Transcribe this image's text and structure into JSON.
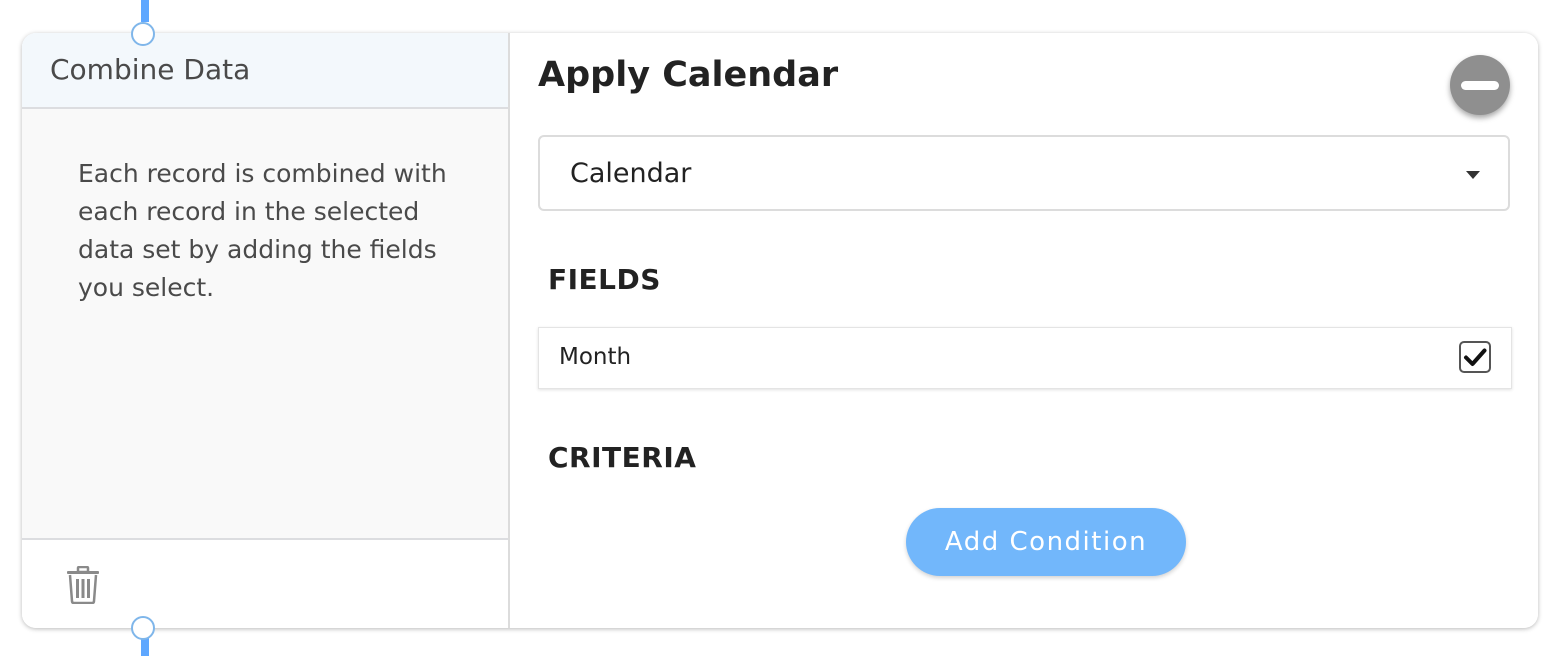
{
  "left_panel": {
    "title": "Combine Data",
    "description": "Each record is combined with each record in the selected data set by adding the fields you select.",
    "delete_icon": "trash-icon"
  },
  "right_panel": {
    "title": "Apply Calendar",
    "remove_icon": "minus-circle-icon",
    "select": {
      "value": "Calendar",
      "icon": "chevron-down-icon"
    },
    "fields": {
      "heading": "FIELDS",
      "items": [
        {
          "label": "Month",
          "checked": true
        }
      ]
    },
    "criteria": {
      "heading": "CRITERIA",
      "add_button_label": "Add Condition"
    }
  },
  "colors": {
    "accent": "#72b7fb",
    "connector": "#5ea7ff",
    "remove_button": "#8f8f8f"
  }
}
